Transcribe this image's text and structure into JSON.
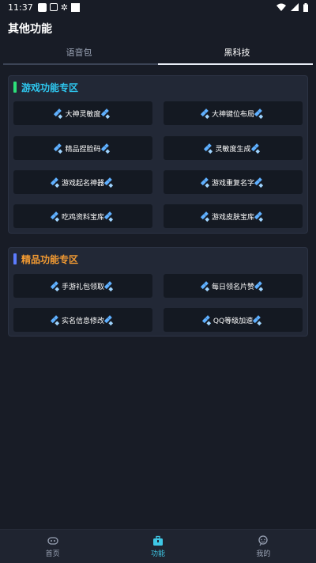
{
  "status_bar": {
    "time": "11:37"
  },
  "app": {
    "title": "其他功能"
  },
  "tabs": [
    {
      "label": "语音包",
      "active": false
    },
    {
      "label": "黑科技",
      "active": true
    }
  ],
  "sections": [
    {
      "title": "游戏功能专区",
      "title_color": "#2ec8f0",
      "bar_color": "#2de07a",
      "buttons": [
        {
          "label": "大神灵敏度"
        },
        {
          "label": "大神键位布局"
        },
        {
          "label": "精品捏脸码"
        },
        {
          "label": "灵敏度生成"
        },
        {
          "label": "游戏起名神器"
        },
        {
          "label": "游戏重复名字"
        },
        {
          "label": "吃鸡资料宝库"
        },
        {
          "label": "游戏皮肤宝库"
        }
      ]
    },
    {
      "title": "精品功能专区",
      "title_color": "#f29a32",
      "bar_color": "#5c7cff",
      "buttons": [
        {
          "label": "手游礼包领取"
        },
        {
          "label": "每日领名片赞"
        },
        {
          "label": "实名信息修改"
        },
        {
          "label": "QQ等级加速"
        }
      ]
    }
  ],
  "bottom_nav": [
    {
      "label": "首页",
      "icon": "gamepad-icon",
      "active": false
    },
    {
      "label": "功能",
      "icon": "toolbox-icon",
      "active": true
    },
    {
      "label": "我的",
      "icon": "profile-icon",
      "active": false
    }
  ]
}
